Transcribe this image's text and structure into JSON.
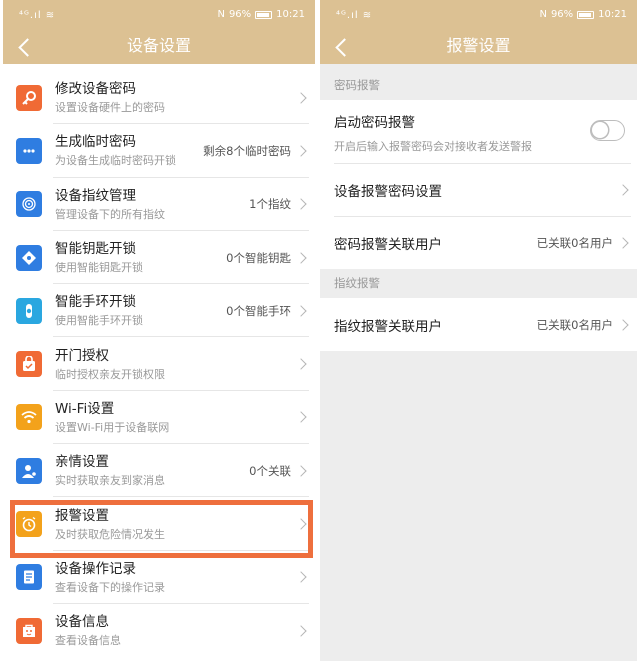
{
  "left": {
    "status": {
      "signal": "⁴ᴳ.ıl ≋",
      "battery": "96%",
      "time": "10:21",
      "nfc": "N"
    },
    "title": "设备设置",
    "items": [
      {
        "label": "修改设备密码",
        "sub": "设置设备硬件上的密码",
        "value": "",
        "icon": "key-icon",
        "color": "#f06a35"
      },
      {
        "label": "生成临时密码",
        "sub": "为设备生成临时密码开锁",
        "value": "剩余8个临时密码",
        "icon": "dots-icon",
        "color": "#2f7de1"
      },
      {
        "label": "设备指纹管理",
        "sub": "管理设备下的所有指纹",
        "value": "1个指纹",
        "icon": "fingerprint-icon",
        "color": "#2f7de1"
      },
      {
        "label": "智能钥匙开锁",
        "sub": "使用智能钥匙开锁",
        "value": "0个智能钥匙",
        "icon": "smart-key-icon",
        "color": "#2f7de1"
      },
      {
        "label": "智能手环开锁",
        "sub": "使用智能手环开锁",
        "value": "0个智能手环",
        "icon": "wristband-icon",
        "color": "#2aa7e0"
      },
      {
        "label": "开门授权",
        "sub": "临时授权亲友开锁权限",
        "value": "",
        "icon": "authorize-icon",
        "color": "#f06a35"
      },
      {
        "label": "Wi-Fi设置",
        "sub": "设置Wi-Fi用于设备联网",
        "value": "",
        "icon": "wifi-icon",
        "color": "#f3a21b"
      },
      {
        "label": "亲情设置",
        "sub": "实时获取亲友到家消息",
        "value": "0个关联",
        "icon": "family-icon",
        "color": "#2f7de1"
      },
      {
        "label": "报警设置",
        "sub": "及时获取危险情况发生",
        "value": "",
        "icon": "alarm-clock-icon",
        "color": "#f3a21b"
      },
      {
        "label": "设备操作记录",
        "sub": "查看设备下的操作记录",
        "value": "",
        "icon": "record-icon",
        "color": "#2f7de1"
      },
      {
        "label": "设备信息",
        "sub": "查看设备信息",
        "value": "",
        "icon": "info-icon",
        "color": "#f06a35"
      }
    ]
  },
  "right": {
    "status": {
      "signal": "⁴ᴳ.ıl ≋",
      "battery": "96%",
      "time": "10:21",
      "nfc": "N"
    },
    "title": "报警设置",
    "section1": "密码报警",
    "enable_label": "启动密码报警",
    "enable_sub": "开启后输入报警密码会对接收者发送警报",
    "enable_on": false,
    "pwd_setting_label": "设备报警密码设置",
    "pwd_users_label": "密码报警关联用户",
    "pwd_users_value": "已关联0名用户",
    "section2": "指纹报警",
    "fp_users_label": "指纹报警关联用户",
    "fp_users_value": "已关联0名用户"
  }
}
